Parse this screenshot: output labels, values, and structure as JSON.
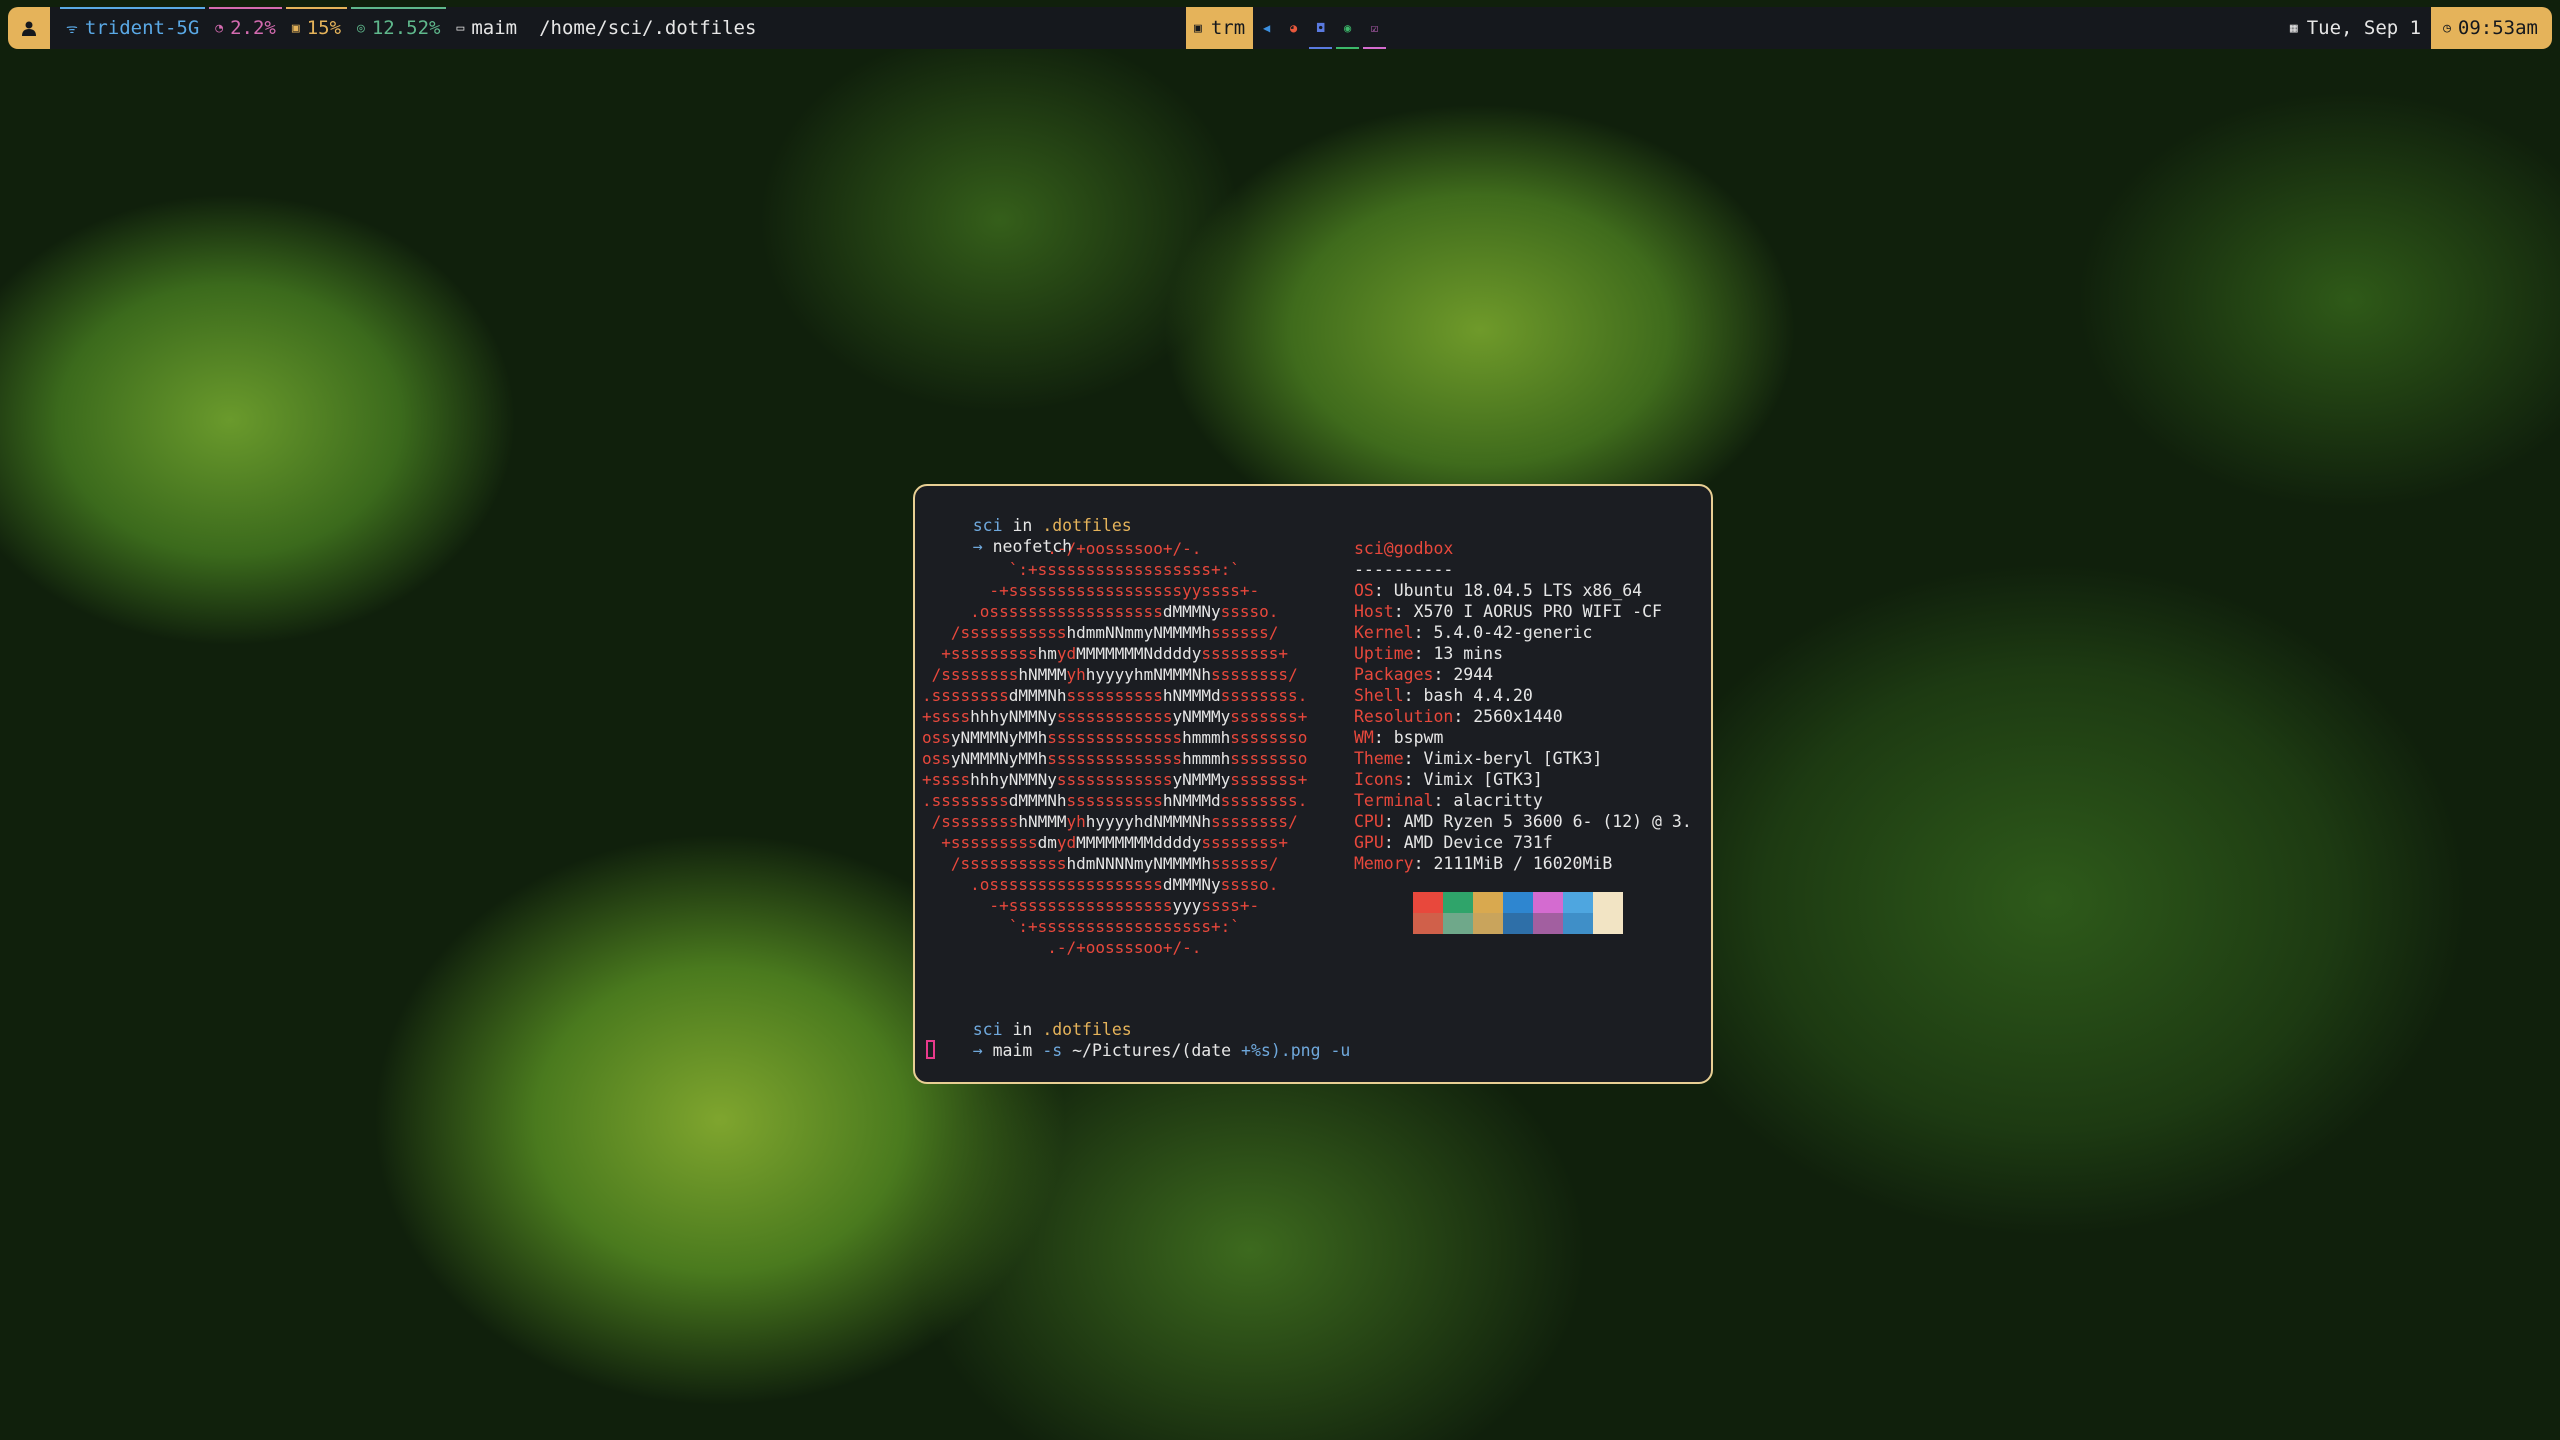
{
  "topbar": {
    "user_icon": "user-icon",
    "network": {
      "icon": "wifi-icon",
      "ssid": "trident-5G",
      "color": "#5aa9e6"
    },
    "cpu": {
      "icon": "gauge-icon",
      "value": "2.2%",
      "color": "#d46bb0"
    },
    "memory": {
      "icon": "memory-icon",
      "value": "15%",
      "color": "#e5b35a"
    },
    "disk": {
      "icon": "disk-icon",
      "value": "12.52%",
      "color": "#5fb88c"
    },
    "window": {
      "icon": "window-icon",
      "name": "maim",
      "path": "/home/sci/.dotfiles"
    },
    "workspaces": [
      {
        "label": "trm",
        "icon": "terminal-icon",
        "active": true
      },
      {
        "icon": "vscode-icon",
        "color": "#3b8fe0"
      },
      {
        "icon": "firefox-icon",
        "color": "#e8583c"
      },
      {
        "icon": "discord-icon",
        "color": "#5a7ae0"
      },
      {
        "icon": "spotify-icon",
        "color": "#3cb86a"
      },
      {
        "icon": "check-icon",
        "color": "#d46bd0"
      }
    ],
    "date": {
      "icon": "calendar-icon",
      "text": "Tue, Sep 1"
    },
    "time": {
      "icon": "clock-icon",
      "text": "09:53am"
    }
  },
  "terminal": {
    "prompt1": {
      "user": "sci",
      "in": "in",
      "dir": ".dotfiles",
      "arrow": "→",
      "command": "neofetch"
    },
    "prompt2": {
      "user": "sci",
      "in": "in",
      "dir": ".dotfiles",
      "arrow": "→",
      "cmd": "maim",
      "flag": "-s",
      "arg1": "~/Pictures/",
      "arg2": "(date",
      "arg3": "+%s)",
      "arg4": ".png",
      "arg5": "-u"
    },
    "neofetch": {
      "user_host": "sci@godbox",
      "separator": "----------",
      "fields": [
        {
          "key": "OS",
          "value": "Ubuntu 18.04.5 LTS x86_64"
        },
        {
          "key": "Host",
          "value": "X570 I AORUS PRO WIFI -CF"
        },
        {
          "key": "Kernel",
          "value": "5.4.0-42-generic"
        },
        {
          "key": "Uptime",
          "value": "13 mins"
        },
        {
          "key": "Packages",
          "value": "2944"
        },
        {
          "key": "Shell",
          "value": "bash 4.4.20"
        },
        {
          "key": "Resolution",
          "value": "2560x1440"
        },
        {
          "key": "WM",
          "value": "bspwm"
        },
        {
          "key": "Theme",
          "value": "Vimix-beryl [GTK3]"
        },
        {
          "key": "Icons",
          "value": "Vimix [GTK3]"
        },
        {
          "key": "Terminal",
          "value": "alacritty"
        },
        {
          "key": "CPU",
          "value": "AMD Ryzen 5 3600 6- (12) @ 3."
        },
        {
          "key": "GPU",
          "value": "AMD Device 731f"
        },
        {
          "key": "Memory",
          "value": "2111MiB / 16020MiB"
        }
      ],
      "palette_top": [
        "#1b1d22",
        "#e8483c",
        "#2fa46a",
        "#d9a94f",
        "#2e86d0",
        "#d46bd0",
        "#4ea6e0",
        "#f2e4c4"
      ],
      "palette_bottom": [
        "#1b1d22",
        "#d0604a",
        "#6fa88a",
        "#c9a45c",
        "#2e6fa8",
        "#a25fa0",
        "#3f8fc8",
        "#f2e4c4"
      ]
    }
  }
}
